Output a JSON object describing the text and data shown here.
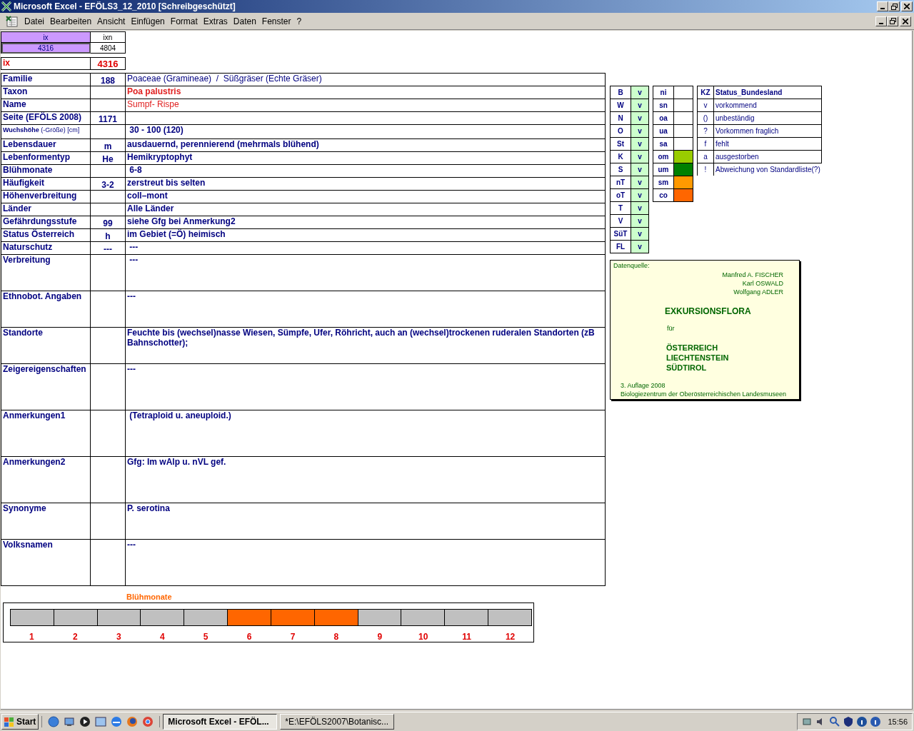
{
  "window": {
    "title": "Microsoft Excel - EFÖLS3_12_2010  [Schreibgeschützt]"
  },
  "menu": [
    "Datei",
    "Bearbeiten",
    "Ansicht",
    "Einfügen",
    "Format",
    "Extras",
    "Daten",
    "Fenster",
    "?"
  ],
  "index_table": {
    "headers": [
      "ix",
      "ixn"
    ],
    "values": [
      "4316",
      "4804"
    ]
  },
  "ix_field": {
    "label": "ix",
    "value": "4316"
  },
  "record": [
    {
      "kind": "line",
      "label": "Familie",
      "code": "188",
      "value": "Poaceae (Gramineae)  /  Süßgräser (Echte Gräser)",
      "red": false,
      "bold": false
    },
    {
      "kind": "line",
      "label": "Taxon",
      "value": "Poa palustris",
      "red": true,
      "bold": true
    },
    {
      "kind": "line",
      "label": "Name",
      "value": "Sumpf- Rispe",
      "red": true,
      "bold": false
    },
    {
      "kind": "line",
      "label": "Seite (EFÖLS 2008)",
      "code": "1171"
    },
    {
      "kind": "small-label",
      "label": "**Wuchshöhe** (-Größe) [cm]",
      "value": " 30 - 100 (120)",
      "red": false,
      "bold": true
    },
    {
      "kind": "line",
      "label": "Lebensdauer",
      "code": "m",
      "value": "ausdauernd, perennierend (mehrmals blühend)",
      "red": false,
      "bold": true
    },
    {
      "kind": "line",
      "label": "Lebenformentyp",
      "code": "He",
      "value": "Hemikryptophyt",
      "red": false,
      "bold": true
    },
    {
      "kind": "line",
      "label": "Blühmonate",
      "value": " 6-8",
      "red": false,
      "bold": true
    },
    {
      "kind": "line",
      "label": "Häufigkeit",
      "code": "3-2",
      "value": "zerstreut bis selten",
      "red": false,
      "bold": true
    },
    {
      "kind": "line",
      "label": "Höhenverbreitung",
      "value": "coll–mont",
      "red": false,
      "bold": true
    },
    {
      "kind": "line",
      "label": "Länder",
      "value": "Alle Länder",
      "red": false,
      "bold": true
    },
    {
      "kind": "line",
      "label": "Gefährdungsstufe",
      "code": "99",
      "value": "siehe Gfg bei Anmerkung2",
      "red": false,
      "bold": true
    },
    {
      "kind": "line",
      "label": "Status Österreich",
      "code": "h",
      "value": "im Gebiet (=Ö) heimisch",
      "red": false,
      "bold": true
    },
    {
      "kind": "line",
      "label": "Naturschutz",
      "code": "---",
      "value": " ---",
      "red": false,
      "bold": true
    },
    {
      "kind": "box",
      "label": "Verbreitung",
      "value": " ---",
      "red": false,
      "bold": true
    },
    {
      "kind": "box",
      "label": "Ethnobot. Angaben",
      "value": "---",
      "red": false,
      "bold": true
    },
    {
      "kind": "box",
      "label": "Standorte",
      "value": "Feuchte bis (wechsel)nasse Wiesen, Sümpfe, Ufer, Röhricht, auch an (wechsel)trockenen ruderalen Standorten (zB Bahnschotter);",
      "red": false,
      "bold": true
    },
    {
      "kind": "tallbox",
      "label": "Zeigereigenschaften",
      "value": "---",
      "red": false,
      "bold": true
    },
    {
      "kind": "tallbox",
      "label": "Anmerkungen1",
      "value": " (Tetraploid u. aneuploid.)",
      "red": false,
      "bold": true
    },
    {
      "kind": "tallbox",
      "label": "Anmerkungen2",
      "value": "Gfg: Im wAlp u. nVL gef.",
      "red": false,
      "bold": true
    },
    {
      "kind": "box",
      "label": "Synonyme",
      "value": "P. serotina",
      "red": false,
      "bold": true
    },
    {
      "kind": "tallbox",
      "label": "Volksnamen",
      "value": "---",
      "red": false,
      "bold": true
    }
  ],
  "regions": [
    {
      "code": "B",
      "status": "v"
    },
    {
      "code": "W",
      "status": "v"
    },
    {
      "code": "N",
      "status": "v"
    },
    {
      "code": "O",
      "status": "v"
    },
    {
      "code": "St",
      "status": "v"
    },
    {
      "code": "K",
      "status": "v"
    },
    {
      "code": "S",
      "status": "v"
    },
    {
      "code": "nT",
      "status": "v"
    },
    {
      "code": "oT",
      "status": "v"
    },
    {
      "code": "T",
      "status": "v"
    },
    {
      "code": "V",
      "status": "v"
    },
    {
      "code": "SüT",
      "status": "v"
    },
    {
      "code": "FL",
      "status": "v"
    }
  ],
  "zones": [
    {
      "code": "ni"
    },
    {
      "code": "sn"
    },
    {
      "code": "oa"
    },
    {
      "code": "ua"
    },
    {
      "code": "sa"
    },
    {
      "code": "om",
      "color": "#99cc00"
    },
    {
      "code": "um",
      "color": "#008000"
    },
    {
      "code": "sm",
      "color": "#ff9900"
    },
    {
      "code": "co",
      "color": "#ff6600"
    }
  ],
  "legend": {
    "headers": [
      "KZ",
      "Status_Bundesland"
    ],
    "rows": [
      {
        "code": "v",
        "meaning": "vorkommend"
      },
      {
        "code": "()",
        "meaning": "unbeständig"
      },
      {
        "code": "?",
        "meaning": "Vorkommen fraglich"
      },
      {
        "code": "f",
        "meaning": "fehlt"
      },
      {
        "code": "a",
        "meaning": "ausgestorben"
      },
      {
        "code": "!",
        "meaning": "Abweichung von Standardliste(?)"
      }
    ]
  },
  "source": {
    "heading": "Datenquelle:",
    "authors": [
      "Manfred A. FISCHER",
      "Karl OSWALD",
      "Wolfgang ADLER"
    ],
    "title": "EXKURSIONSFLORA",
    "for": "für",
    "regions": [
      "ÖSTERREICH",
      "LIECHTENSTEIN",
      "SÜDTIROL"
    ],
    "edition": "3. Auflage 2008",
    "publisher": "Biologiezentrum der Oberösterreichischen Landesmuseen"
  },
  "flowering": {
    "title": "Blühmonate",
    "months": [
      {
        "label": "1",
        "on": false
      },
      {
        "label": "2",
        "on": false
      },
      {
        "label": "3",
        "on": false
      },
      {
        "label": "4",
        "on": false
      },
      {
        "label": "5",
        "on": false
      },
      {
        "label": "6",
        "on": true
      },
      {
        "label": "7",
        "on": true
      },
      {
        "label": "8",
        "on": true
      },
      {
        "label": "9",
        "on": false
      },
      {
        "label": "10",
        "on": false
      },
      {
        "label": "11",
        "on": false
      },
      {
        "label": "12",
        "on": false
      }
    ]
  },
  "taskbar": {
    "start": "Start",
    "tasks": [
      {
        "label": "Microsoft Excel - EFÖL...",
        "selected": true
      },
      {
        "label": "*E:\\EFÖLS2007\\Botanisc...",
        "selected": false
      }
    ],
    "clock": "15:56"
  }
}
